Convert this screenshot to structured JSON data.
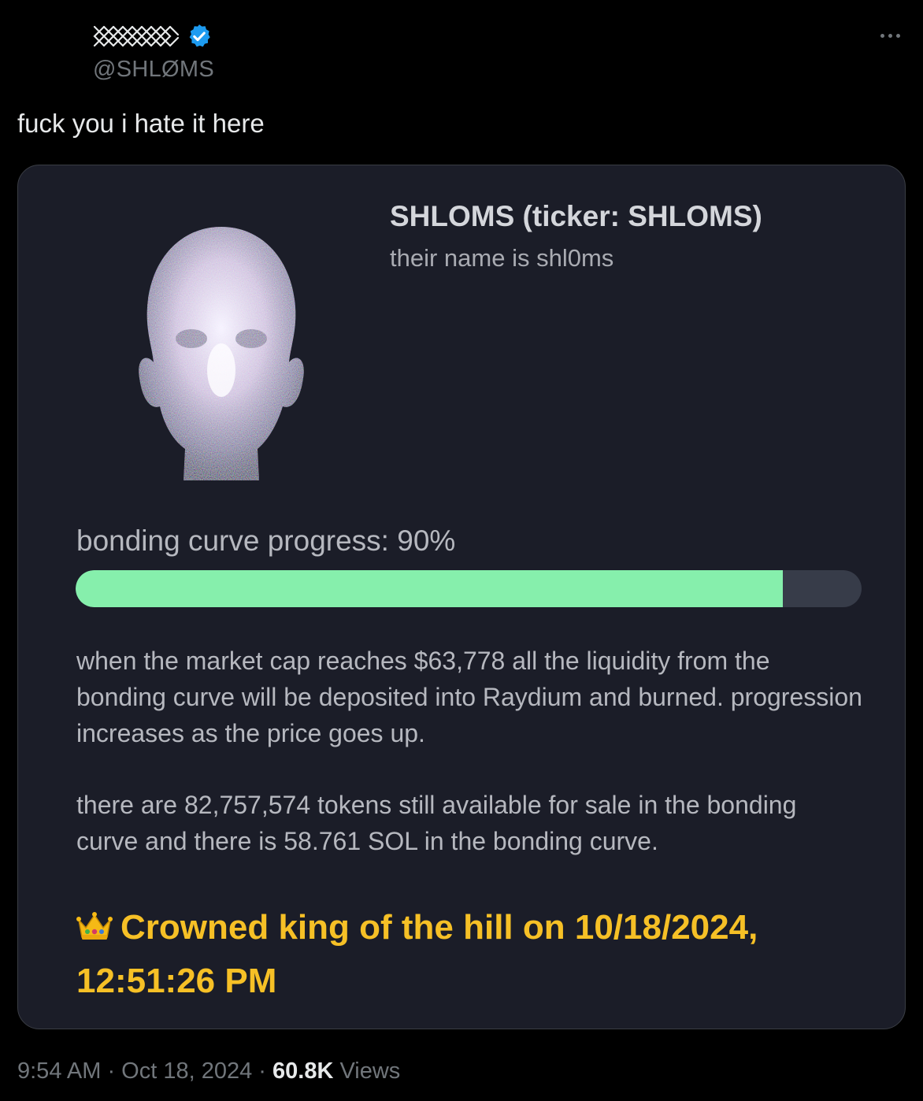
{
  "author": {
    "handle": "@SHLØMS",
    "verified": true,
    "badge_color": "#1d9bf0",
    "display_name_icon": "lattice-pattern-icon"
  },
  "tweet": {
    "text": "fuck you i hate it here"
  },
  "card": {
    "image_icon": "glitch-head-image",
    "title": "SHLOMS (ticker: SHLOMS)",
    "description": "their name is shl0ms",
    "progress_label": "bonding curve progress: 90%",
    "progress_value": 0.9,
    "progress_fill_color": "#86efac",
    "progress_track_color": "#373c49",
    "paragraph_1": "when the market cap reaches $63,778 all the liquidity from the bonding curve will be deposited into Raydium and burned. progression increases as the price goes up.",
    "paragraph_2": "there are 82,757,574 tokens still available for sale in the bonding curve and there is 58.761 SOL in the bonding curve.",
    "koth_icon": "crown-icon",
    "koth_text": "Crowned king of the hill on 10/18/2024, 12:51:26 PM",
    "koth_color": "#f6c026"
  },
  "meta": {
    "time_date": "9:54 AM · Oct 18, 2024 · ",
    "views_count": "60.8K",
    "views_label": " Views"
  }
}
